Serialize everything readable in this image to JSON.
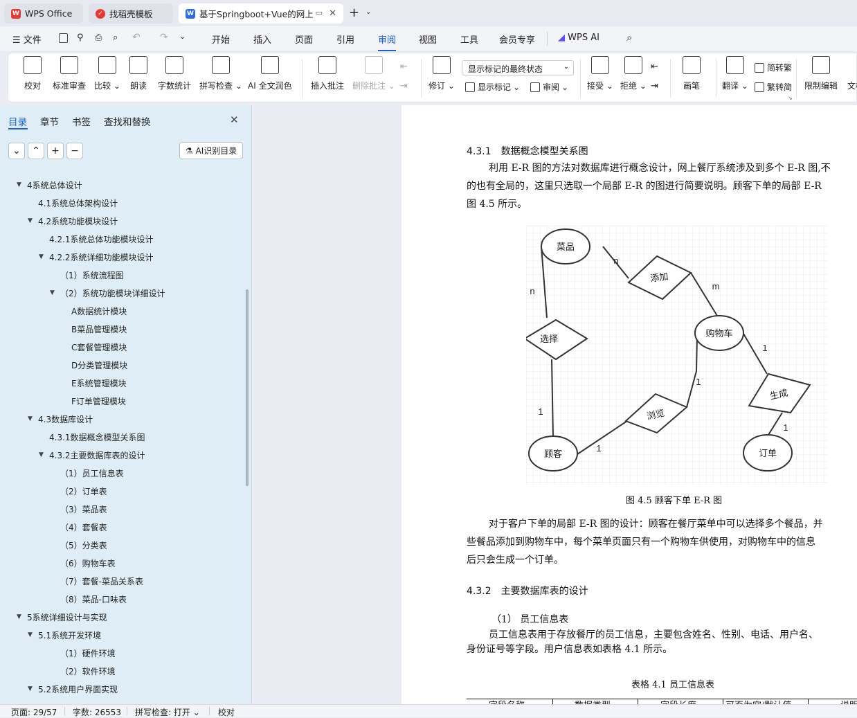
{
  "tabs": [
    {
      "label": "WPS Office"
    },
    {
      "label": "找稻壳模板"
    },
    {
      "label": "基于Springboot+Vue的网上"
    }
  ],
  "menubar": {
    "file": "文件",
    "items": [
      "开始",
      "插入",
      "页面",
      "引用",
      "审阅",
      "视图",
      "工具",
      "会员专享"
    ],
    "ai": "WPS AI",
    "active": "审阅"
  },
  "ribbon": {
    "proofread": "校对",
    "std_review": "标准审查",
    "compare": "比较",
    "read_aloud": "朗读",
    "word_count": "字数统计",
    "spell_check": "拼写检查",
    "ai_polish": "AI 全文润色",
    "insert_comment": "插入批注",
    "delete_comment": "删除批注",
    "revise": "修订",
    "display_mode": "显示标记的最终状态",
    "show_marks": "显示标记",
    "review": "审阅",
    "accept": "接受",
    "reject": "拒绝",
    "pen": "画笔",
    "translate": "翻译",
    "to_trad": "简转繁",
    "to_simp": "繁转简",
    "restrict": "限制编辑",
    "doc_more": "文档"
  },
  "sidebar": {
    "tabs": [
      "目录",
      "章节",
      "书签",
      "查找和替换"
    ],
    "ai_button": "AI识别目录",
    "toc": [
      {
        "label": "4系统总体设计",
        "level": 1,
        "expanded": true
      },
      {
        "label": "4.1系统总体架构设计",
        "level": 2
      },
      {
        "label": "4.2系统功能模块设计",
        "level": 2,
        "expanded": true
      },
      {
        "label": "4.2.1系统总体功能模块设计",
        "level": 3
      },
      {
        "label": "4.2.2系统详细功能模块设计",
        "level": 3,
        "expanded": true
      },
      {
        "label": "（1）系统流程图",
        "level": 4
      },
      {
        "label": "（2）系统功能模块详细设计",
        "level": 4,
        "expanded": true
      },
      {
        "label": "A数据统计模块",
        "level": 5
      },
      {
        "label": "B菜品管理模块",
        "level": 5
      },
      {
        "label": "C套餐管理模块",
        "level": 5
      },
      {
        "label": "D分类管理模块",
        "level": 5
      },
      {
        "label": "E系统管理模块",
        "level": 5
      },
      {
        "label": "F订单管理模块",
        "level": 5
      },
      {
        "label": "4.3数据库设计",
        "level": 2,
        "expanded": true
      },
      {
        "label": "4.3.1数据概念模型关系图",
        "level": 3
      },
      {
        "label": "4.3.2主要数据库表的设计",
        "level": 3,
        "expanded": true
      },
      {
        "label": "（1）员工信息表",
        "level": 4
      },
      {
        "label": "（2）订单表",
        "level": 4
      },
      {
        "label": "（3）菜品表",
        "level": 4
      },
      {
        "label": "（4）套餐表",
        "level": 4
      },
      {
        "label": "（5）分类表",
        "level": 4
      },
      {
        "label": "（6）购物车表",
        "level": 4
      },
      {
        "label": "（7）套餐-菜品关系表",
        "level": 4
      },
      {
        "label": "（8）菜品-口味表",
        "level": 4
      },
      {
        "label": "5系统详细设计与实现",
        "level": 1,
        "expanded": true
      },
      {
        "label": "5.1系统开发环境",
        "level": 2,
        "expanded": true
      },
      {
        "label": "（1）硬件环境",
        "level": 4
      },
      {
        "label": "（2）软件环境",
        "level": 4
      },
      {
        "label": "5.2系统用户界面实现",
        "level": 2,
        "expanded": true
      }
    ]
  },
  "document": {
    "h431": "4.3.1　数据概念模型关系图",
    "p1": [
      "利用 E-R 图的方法对数据库进行概念设计，网上餐厅系统涉及到多个 E-R 图,不",
      "的也有全局的，这里只选取一个局部 E-R 的图进行简要说明。顾客下单的局部 E-R",
      "图  4.5 所示。"
    ],
    "er": {
      "entities": [
        "菜品",
        "购物车",
        "顾客",
        "订单"
      ],
      "relations": [
        "添加",
        "选择",
        "浏览",
        "生成"
      ],
      "cardinalities": [
        "n",
        "m",
        "n",
        "1",
        "1",
        "1",
        "1",
        "1"
      ]
    },
    "caption": "图  4.5  顾客下单 E-R 图",
    "p2": [
      "对于客户下单的局部 E-R 图的设计：顾客在餐厅菜单中可以选择多个餐品，并",
      "些餐品添加到购物车中，每个菜单页面只有一个购物车供使用，对购物车中的信息",
      "后只会生成一个订单。"
    ],
    "h432": "4.3.2　主要数据库表的设计",
    "sub1": "（1）  员工信息表",
    "p3": [
      "员工信息表用于存放餐厅的员工信息，主要包含姓名、性别、电话、用户名、",
      "身份证号等字段。用户信息表如表格  4.1 所示。"
    ],
    "table_caption": "表格  4.1 员工信息表",
    "table_headers": [
      "字段名称",
      "数据类型",
      "字段长度",
      "可否为空/默认值",
      "说明"
    ]
  },
  "status": {
    "page": "页面: 29/57",
    "words": "字数: 26553",
    "spell": "拼写检查: 打开",
    "proof": "校对"
  }
}
